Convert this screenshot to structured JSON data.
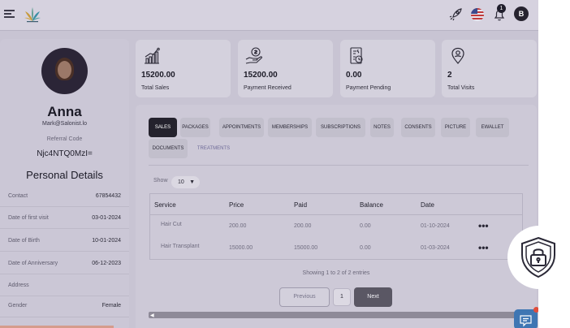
{
  "header": {
    "notification_count": "1",
    "user_initial": "B",
    "icons": [
      "menu-icon",
      "brand-logo",
      "rocket-icon",
      "us-flag-icon",
      "bell-icon"
    ]
  },
  "profile": {
    "name": "Anna",
    "email": "Mark@Salonist.lo",
    "referral_label": "Referral Code",
    "referral_code": "Njc4NTQ0MzI=",
    "section_title": "Personal Details",
    "details": [
      {
        "label": "Contact",
        "value": "67854432"
      },
      {
        "label": "Date of first visit",
        "value": "03-01-2024"
      },
      {
        "label": "Date of Birth",
        "value": "10-01-2024"
      },
      {
        "label": "Date of Anniversary",
        "value": "06-12-2023"
      },
      {
        "label": "Address",
        "value": ""
      },
      {
        "label": "Gender",
        "value": "Female"
      }
    ]
  },
  "stats": [
    {
      "value": "15200.00",
      "label": "Total Sales",
      "icon": "sales-chart-icon"
    },
    {
      "value": "15200.00",
      "label": "Payment Received",
      "icon": "payment-hand-icon"
    },
    {
      "value": "0.00",
      "label": "Payment Pending",
      "icon": "invoice-pending-icon"
    },
    {
      "value": "2",
      "label": "Total Visits",
      "icon": "location-pin-icon"
    }
  ],
  "tabs": [
    {
      "label": "SALES",
      "active": true
    },
    {
      "label": "PACKAGES"
    },
    {
      "label": "APPOINTMENTS"
    },
    {
      "label": "MEMBERSHIPS"
    },
    {
      "label": "SUBSCRIPTIONS"
    },
    {
      "label": "NOTES"
    },
    {
      "label": "CONSENTS"
    },
    {
      "label": "PICTURE"
    },
    {
      "label": "EWALLET"
    },
    {
      "label": "DOCUMENTS"
    },
    {
      "label": "TREATMENTS"
    }
  ],
  "table": {
    "show_label": "Show",
    "page_size": "10",
    "columns": [
      "Service",
      "Price",
      "Paid",
      "Balance",
      "Date"
    ],
    "rows": [
      [
        "Hair Cut",
        "200.00",
        "200.00",
        "0.00",
        "01-10-2024"
      ],
      [
        "Hair Transplant",
        "15000.00",
        "15000.00",
        "0.00",
        "01-03-2024"
      ]
    ],
    "row_menu": "•••",
    "entries_text": "Showing 1 to 2 of 2 entries"
  },
  "pagination": {
    "previous": "Previous",
    "current_page": "1",
    "next": "Next"
  },
  "colors": {
    "overlay": "#c8c4d3",
    "active_tab": "#24222d",
    "chat_button": "#3f76b3",
    "alert_dot": "#e04d3b"
  }
}
